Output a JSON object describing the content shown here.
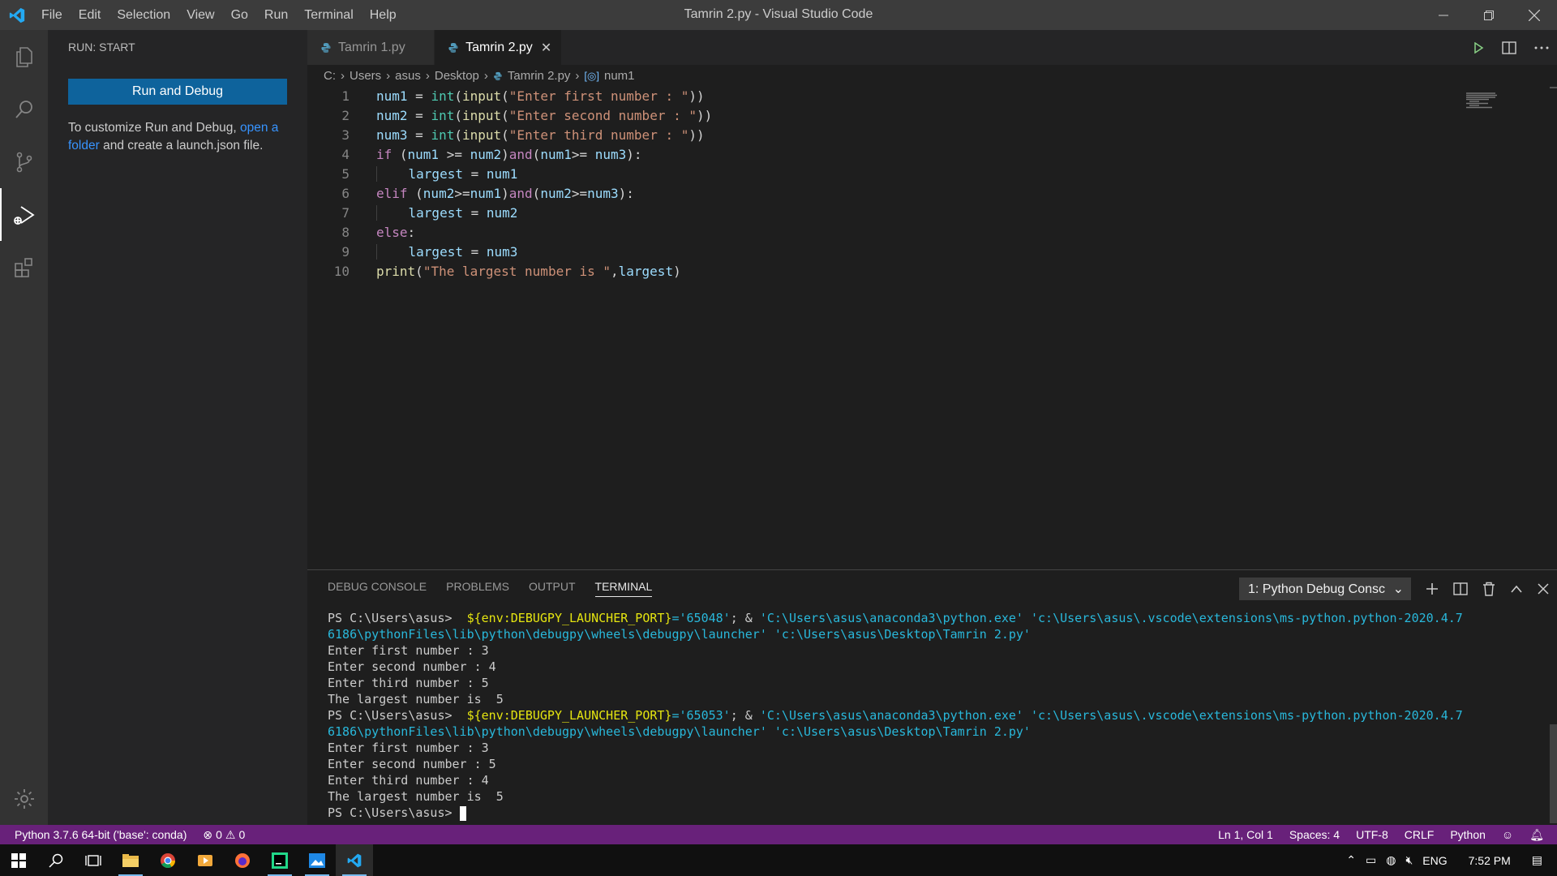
{
  "window": {
    "title": "Tamrin 2.py - Visual Studio Code"
  },
  "menu": [
    "File",
    "Edit",
    "Selection",
    "View",
    "Go",
    "Run",
    "Terminal",
    "Help"
  ],
  "sidebar": {
    "header": "RUN: START",
    "run_button": "Run and Debug",
    "help_pre": "To customize Run and Debug, ",
    "help_link": "open a folder",
    "help_post": " and create a launch.json file."
  },
  "tabs": [
    {
      "label": "Tamrin 1.py",
      "active": false
    },
    {
      "label": "Tamrin 2.py",
      "active": true
    }
  ],
  "breadcrumb": {
    "items": [
      "C:",
      "Users",
      "asus",
      "Desktop",
      "Tamrin 2.py"
    ],
    "symbol": "num1"
  },
  "code": {
    "line_numbers": [
      "1",
      "2",
      "3",
      "4",
      "5",
      "6",
      "7",
      "8",
      "9",
      "10"
    ],
    "lines": [
      "num1 = int(input(\"Enter first number : \"))",
      "num2 = int(input(\"Enter second number : \"))",
      "num3 = int(input(\"Enter third number : \"))",
      "if (num1 >= num2)and(num1>= num3):",
      "    largest = num1",
      "elif (num2>=num1)and(num2>=num3):",
      "    largest = num2",
      "else:",
      "    largest = num3",
      "print(\"The largest number is \",largest)"
    ]
  },
  "panel": {
    "tabs": [
      "DEBUG CONSOLE",
      "PROBLEMS",
      "OUTPUT",
      "TERMINAL"
    ],
    "active_tab": "TERMINAL",
    "terminal_select": "1: Python Debug Consc",
    "terminal": {
      "prompt": "PS C:\\Users\\asus>",
      "cmd1_env": "${env:DEBUGPY_LAUNCHER_PORT}",
      "cmd1_port": "='65048'",
      "amp": "; &",
      "python_path": "'C:\\Users\\asus\\anaconda3\\python.exe'",
      "launcher_path_1": "'c:\\Users\\asus\\.vscode\\extensions\\ms-python.python-2020.4.7",
      "launcher_path_2": "6186\\pythonFiles\\lib\\python\\debugpy\\wheels\\debugpy\\launcher'",
      "script_path": "'c:\\Users\\asus\\Desktop\\Tamrin 2.py'",
      "run1": [
        "Enter first number : 3",
        "Enter second number : 4",
        "Enter third number : 5",
        "The largest number is  5"
      ],
      "cmd2_port": "='65053'",
      "run2": [
        "Enter first number : 3",
        "Enter second number : 5",
        "Enter third number : 4",
        "The largest number is  5"
      ]
    }
  },
  "status": {
    "interpreter": "Python 3.7.6 64-bit ('base': conda)",
    "errors": "0",
    "warnings": "0",
    "position": "Ln 1, Col 1",
    "spaces": "Spaces: 4",
    "encoding": "UTF-8",
    "eol": "CRLF",
    "language": "Python"
  },
  "taskbar": {
    "lang": "ENG",
    "time": "7:52 PM"
  },
  "colors": {
    "accent": "#68217a",
    "button": "#0e639c",
    "titlebar": "#3c3c3c"
  }
}
